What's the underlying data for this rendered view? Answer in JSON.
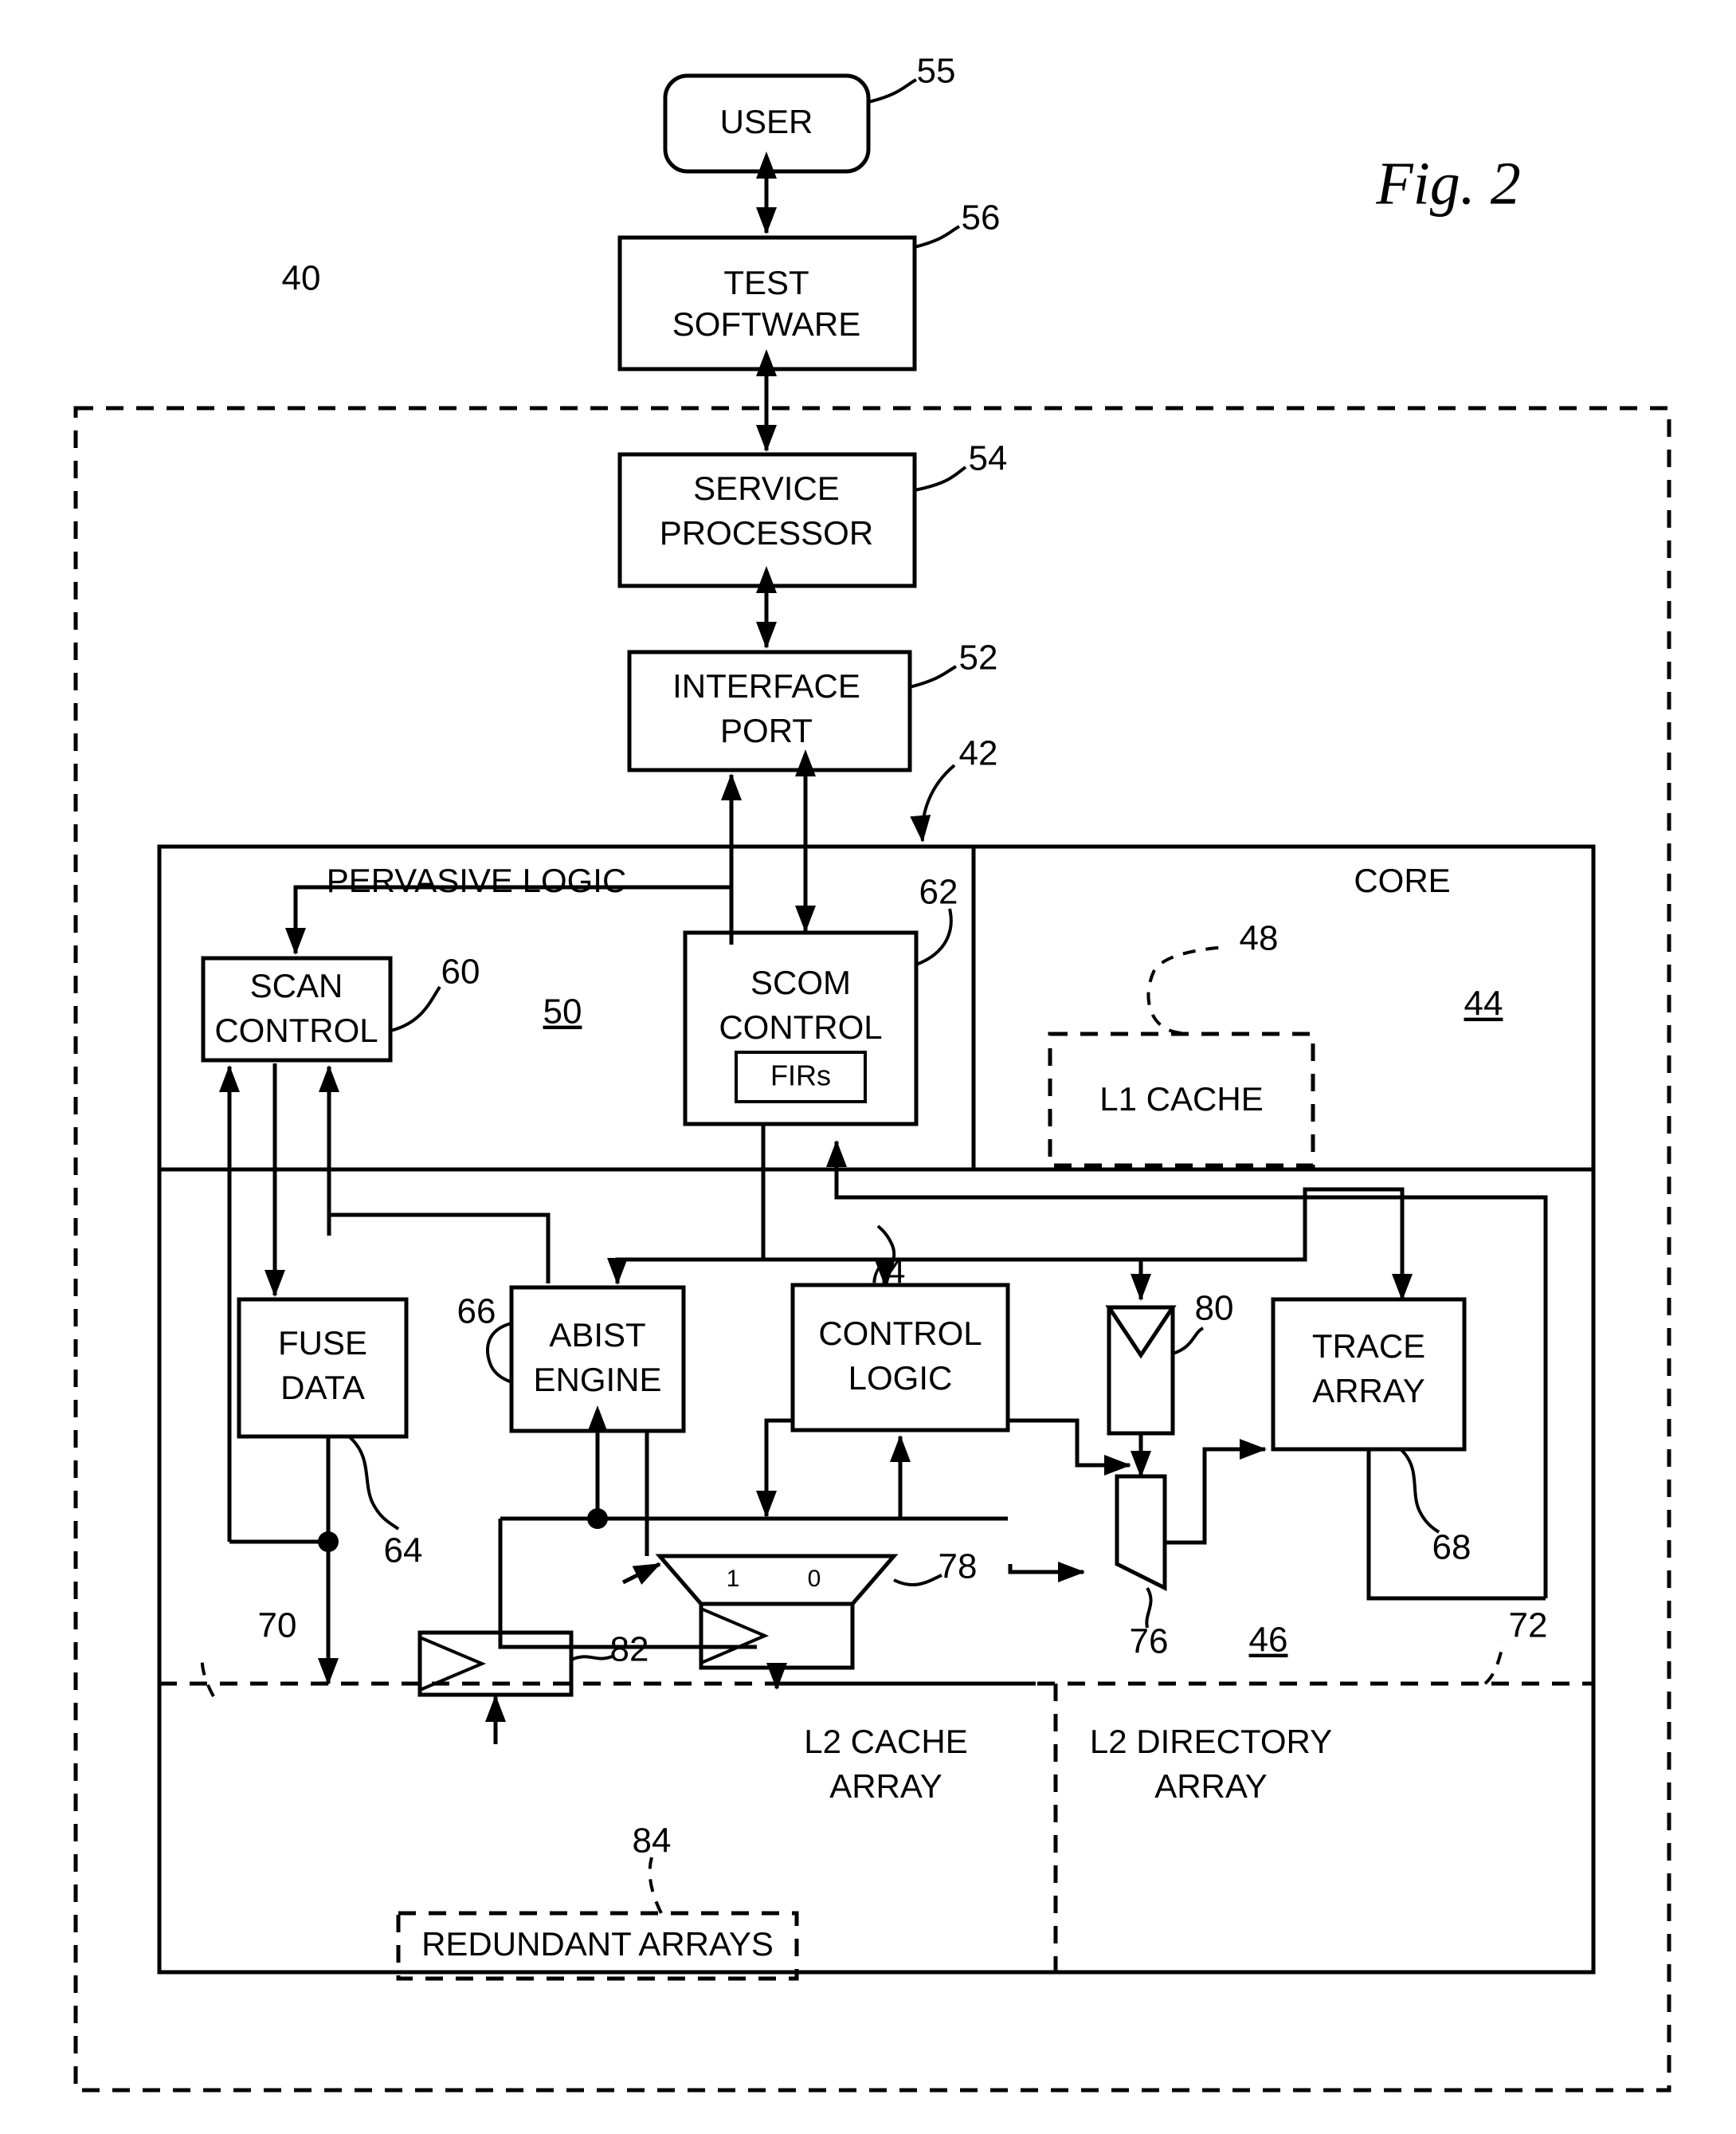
{
  "figure": {
    "label": "Fig. 2"
  },
  "blocks": {
    "user": {
      "label_line1": "USER",
      "ref": "55"
    },
    "test_software": {
      "label_line1": "TEST",
      "label_line2": "SOFTWARE",
      "ref": "56"
    },
    "service_processor": {
      "label_line1": "SERVICE",
      "label_line2": "PROCESSOR",
      "ref": "54"
    },
    "interface_port": {
      "label_line1": "INTERFACE",
      "label_line2": "PORT",
      "ref": "52"
    },
    "pervasive_logic": {
      "label": "PERVASIVE LOGIC",
      "ref": "50"
    },
    "core": {
      "label": "CORE",
      "ref": "44"
    },
    "l1_cache": {
      "label": "L1 CACHE",
      "ref": "48"
    },
    "scan_control": {
      "label_line1": "SCAN",
      "label_line2": "CONTROL",
      "ref": "60"
    },
    "scom_control": {
      "label_line1": "SCOM",
      "label_line2": "CONTROL",
      "ref": "62",
      "firs_label": "FIRs"
    },
    "fuse_data": {
      "label_line1": "FUSE",
      "label_line2": "DATA",
      "ref": "64"
    },
    "abist_engine": {
      "label_line1": "ABIST",
      "label_line2": "ENGINE",
      "ref": "66"
    },
    "control_logic": {
      "label_line1": "CONTROL",
      "label_line2": "LOGIC",
      "ref": "74"
    },
    "trace_array": {
      "label_line1": "TRACE",
      "label_line2": "ARRAY",
      "ref": "68"
    },
    "comparator": {
      "ref": "80"
    },
    "output_mux": {
      "ref": "76"
    },
    "input_mux": {
      "ref": "78",
      "sel_left": "1",
      "sel_right": "0"
    },
    "driver_buffer": {
      "ref": "82"
    },
    "array_region": {
      "ref": "46"
    },
    "l2_cache_array": {
      "label_line1": "L2 CACHE",
      "label_line2": "ARRAY"
    },
    "l2_directory_array": {
      "label_line1": "L2 DIRECTORY",
      "label_line2": "ARRAY"
    },
    "redundant_arrays": {
      "label": "REDUNDANT ARRAYS",
      "ref": "84"
    }
  },
  "boundaries": {
    "system": {
      "ref": "40"
    },
    "chip": {
      "ref": "42"
    },
    "array_boundary_left": {
      "ref": "70"
    },
    "array_boundary_right": {
      "ref": "72"
    }
  },
  "chart_data": {
    "type": "diagram",
    "title": "Fig. 2",
    "nodes": [
      {
        "id": "55",
        "label": "USER",
        "shape": "rounded-rect"
      },
      {
        "id": "56",
        "label": "TEST SOFTWARE",
        "shape": "rect"
      },
      {
        "id": "54",
        "label": "SERVICE PROCESSOR",
        "shape": "rect"
      },
      {
        "id": "52",
        "label": "INTERFACE PORT",
        "shape": "rect"
      },
      {
        "id": "50",
        "label": "PERVASIVE LOGIC",
        "shape": "region"
      },
      {
        "id": "44",
        "label": "CORE",
        "shape": "region"
      },
      {
        "id": "48",
        "label": "L1 CACHE",
        "shape": "dashed-rect"
      },
      {
        "id": "60",
        "label": "SCAN CONTROL",
        "shape": "rect"
      },
      {
        "id": "62",
        "label": "SCOM CONTROL",
        "shape": "rect"
      },
      {
        "id": "64",
        "label": "FUSE DATA",
        "shape": "rect"
      },
      {
        "id": "66",
        "label": "ABIST ENGINE",
        "shape": "rect"
      },
      {
        "id": "74",
        "label": "CONTROL LOGIC",
        "shape": "rect"
      },
      {
        "id": "68",
        "label": "TRACE ARRAY",
        "shape": "rect"
      },
      {
        "id": "80",
        "label": "comparator",
        "shape": "compare"
      },
      {
        "id": "76",
        "label": "output mux",
        "shape": "trapezoid"
      },
      {
        "id": "78",
        "label": "input mux",
        "shape": "inverted-trapezoid"
      },
      {
        "id": "82",
        "label": "driver",
        "shape": "buffer"
      },
      {
        "id": "46",
        "label": "array region",
        "shape": "region"
      },
      {
        "id": "84",
        "label": "REDUNDANT ARRAYS",
        "shape": "dashed-rect"
      }
    ],
    "edges": [
      {
        "from": "55",
        "to": "56",
        "type": "bidirectional"
      },
      {
        "from": "56",
        "to": "54",
        "type": "bidirectional"
      },
      {
        "from": "54",
        "to": "52",
        "type": "bidirectional"
      },
      {
        "from": "52",
        "to": "60",
        "type": "directed"
      },
      {
        "from": "52",
        "to": "62",
        "type": "bidirectional"
      },
      {
        "from": "60",
        "to": "64",
        "type": "directed"
      },
      {
        "from": "60",
        "to": "66",
        "type": "directed"
      },
      {
        "from": "62",
        "to": "66",
        "type": "directed"
      },
      {
        "from": "62",
        "to": "74",
        "type": "directed"
      },
      {
        "from": "62",
        "to": "80",
        "type": "directed"
      },
      {
        "from": "62",
        "to": "68",
        "type": "directed"
      },
      {
        "from": "66",
        "to": "78",
        "type": "directed"
      },
      {
        "from": "74",
        "to": "76",
        "type": "directed"
      },
      {
        "from": "80",
        "to": "76",
        "type": "directed"
      },
      {
        "from": "76",
        "to": "68",
        "type": "directed"
      },
      {
        "from": "68",
        "to": "62",
        "type": "directed"
      },
      {
        "from": "64",
        "to": "82",
        "type": "directed"
      },
      {
        "from": "78",
        "to": "46",
        "type": "directed"
      }
    ]
  }
}
